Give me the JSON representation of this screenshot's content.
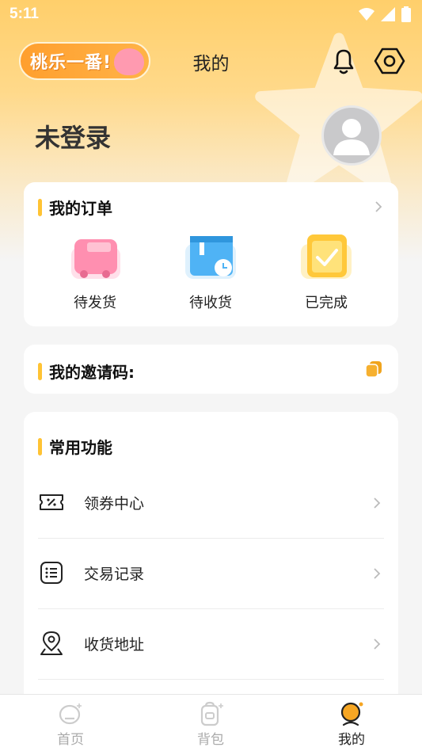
{
  "status_bar": {
    "time": "5:11"
  },
  "header": {
    "logo_text": "桃乐一番!",
    "title": "我的"
  },
  "profile": {
    "login_status": "未登录"
  },
  "orders": {
    "title": "我的订单",
    "items": [
      {
        "label": "待发货",
        "icon": "truck-icon"
      },
      {
        "label": "待收货",
        "icon": "box-clock-icon"
      },
      {
        "label": "已完成",
        "icon": "bag-check-icon"
      }
    ]
  },
  "invite": {
    "title": "我的邀请码:"
  },
  "functions": {
    "title": "常用功能",
    "items": [
      {
        "label": "领券中心",
        "icon": "coupon-icon"
      },
      {
        "label": "交易记录",
        "icon": "list-icon"
      },
      {
        "label": "收货地址",
        "icon": "location-icon"
      }
    ]
  },
  "tabs": [
    {
      "label": "首页",
      "icon": "home-icon",
      "active": false
    },
    {
      "label": "背包",
      "icon": "backpack-icon",
      "active": false
    },
    {
      "label": "我的",
      "icon": "profile-icon",
      "active": true
    }
  ],
  "colors": {
    "accent": "#ffc334",
    "brand": "#ff9f2e",
    "pink": "#ff8fb0",
    "blue": "#4fb3f5"
  }
}
